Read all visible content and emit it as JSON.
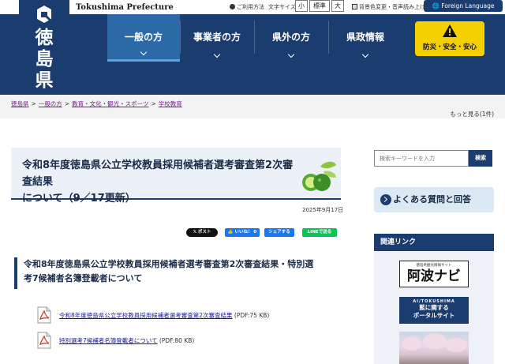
{
  "header": {
    "prefecture_kanji": "徳島県",
    "prefecture_en": "Tokushima Prefecture",
    "utility": {
      "help": "ご利用方法",
      "font_size_label": "文字サイズ",
      "font_small": "小",
      "font_standard": "標準",
      "font_large": "大",
      "color_audio": "背景色変更・音声読み上げ",
      "language": "Foreign Language"
    },
    "nav": [
      {
        "label": "一般の方",
        "active": true
      },
      {
        "label": "事業者の方"
      },
      {
        "label": "県外の方"
      },
      {
        "label": "県政情報"
      }
    ],
    "disaster_label": "防災・安全・安心"
  },
  "breadcrumb": {
    "items": [
      "徳島県",
      "一般の方",
      "教育・文化・観光・スポーツ",
      "学校教育"
    ],
    "separator": ">",
    "more": "もっと見る(1件)"
  },
  "main": {
    "title_line1": "令和8年度徳島県公立学校教員採用候補者選考審査第2次審査結果",
    "title_line2": "について（9／17更新）",
    "date": "2025年9月17日",
    "share": {
      "x": "𝕏 ポスト",
      "facebook": "👍 いいね！ 0",
      "share": "シェアする",
      "line": "LINEで送る"
    },
    "section_heading_line1": "令和8年度徳島県公立学校教員採用候補者選考審査第2次審査結果・特別選",
    "section_heading_line2": "考7候補者名簿登載者について",
    "files": [
      {
        "link": "令和8年度徳島県公立学校教員採用候補者選考審査第2次審査結果",
        "meta": " (PDF:75 KB)"
      },
      {
        "link": "特別選考7候補者名簿登載者について",
        "meta": " (PDF:80 KB)"
      }
    ]
  },
  "sidebar": {
    "search_placeholder": "検索キーワードを入力",
    "search_button": "検索",
    "faq": "よくある質問と回答",
    "related_heading": "関連リンク",
    "awa_small": "徳島県観光情報サイト",
    "awa_big": "阿波ナビ",
    "ai_small": "AI/TOKUSHIMA",
    "ai_line1": "藍に関する",
    "ai_line2": "ポータルサイト"
  },
  "colors": {
    "header_navy": "#1b3c6e",
    "nav_active": "#2b6aa6",
    "disaster_yellow": "#f5d000",
    "breadcrumb_link": "#7a1f8e"
  }
}
